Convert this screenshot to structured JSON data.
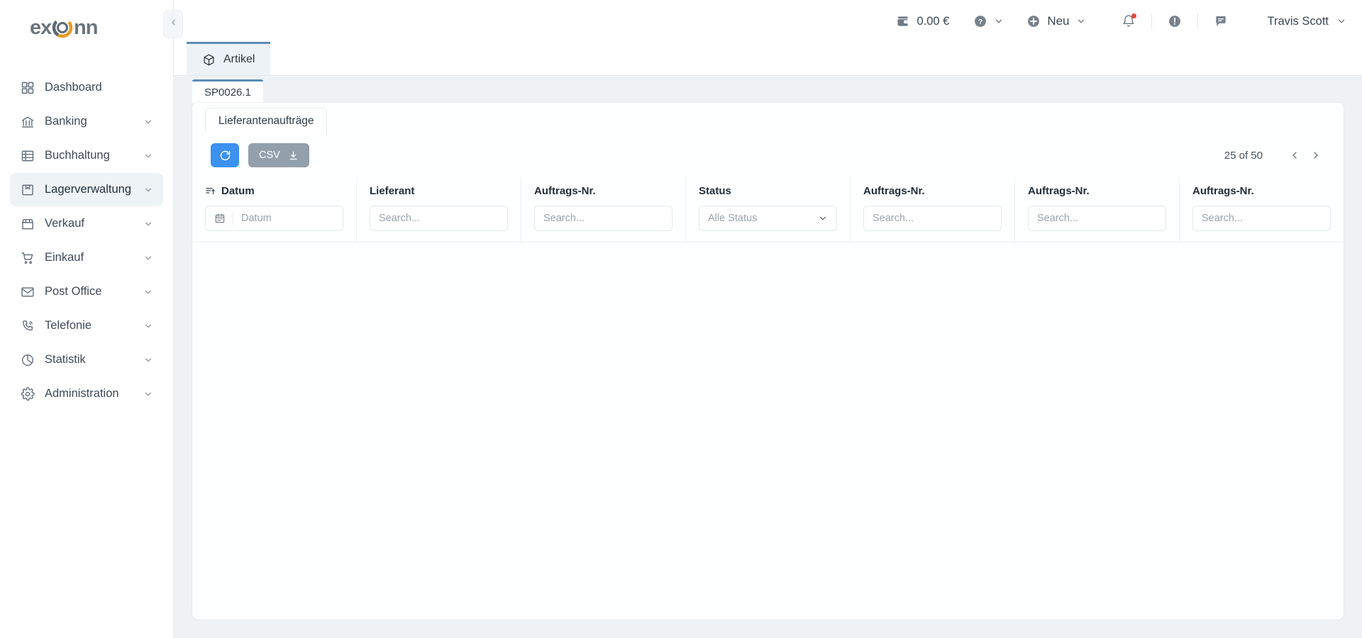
{
  "brand": {
    "name": "exonn",
    "accent": "#e8991f",
    "text_color": "#5e6a73"
  },
  "sidebar": {
    "collapse_icon": "chevron-left-icon",
    "items": [
      {
        "label": "Dashboard",
        "icon": "grid-icon",
        "has_chevron": false,
        "active": false
      },
      {
        "label": "Banking",
        "icon": "bank-icon",
        "has_chevron": true,
        "active": false
      },
      {
        "label": "Buchhaltung",
        "icon": "ledger-icon",
        "has_chevron": true,
        "active": false
      },
      {
        "label": "Lagerverwaltung",
        "icon": "box-archive-icon",
        "has_chevron": true,
        "active": true
      },
      {
        "label": "Verkauf",
        "icon": "store-icon",
        "has_chevron": true,
        "active": false
      },
      {
        "label": "Einkauf",
        "icon": "cart-icon",
        "has_chevron": true,
        "active": false
      },
      {
        "label": "Post Office",
        "icon": "envelope-icon",
        "has_chevron": true,
        "active": false
      },
      {
        "label": "Telefonie",
        "icon": "phone-icon",
        "has_chevron": true,
        "active": false
      },
      {
        "label": "Statistik",
        "icon": "pie-chart-icon",
        "has_chevron": true,
        "active": false
      },
      {
        "label": "Administration",
        "icon": "gear-icon",
        "has_chevron": true,
        "active": false
      }
    ]
  },
  "topbar": {
    "wallet": {
      "icon": "wallet-icon",
      "amount": "0.00 €"
    },
    "help": {
      "icon": "question-circle-icon",
      "chevron": "chevron-down-icon"
    },
    "new": {
      "icon": "plus-circle-icon",
      "label": "Neu",
      "chevron": "chevron-down-icon"
    },
    "notifications": {
      "icon": "bell-icon",
      "has_badge": true,
      "badge_color": "#e8453c"
    },
    "alerts": {
      "icon": "exclamation-circle-icon"
    },
    "messages": {
      "icon": "chat-bubble-icon"
    },
    "user": {
      "name": "Travis Scott",
      "chevron": "chevron-down-icon"
    }
  },
  "tabs": {
    "main": {
      "label": "Artikel",
      "icon": "cube-icon",
      "active": true,
      "accent": "#5b8db8"
    },
    "sub": {
      "label": "SP0026.1",
      "active": true
    },
    "inner": {
      "label": "Lieferantenaufträge",
      "active": true
    }
  },
  "toolbar": {
    "refresh": {
      "icon": "refresh-icon",
      "label": "",
      "color": "#3b92ef"
    },
    "csv": {
      "label": "CSV",
      "icon": "download-icon",
      "color": "#93a0ab"
    },
    "pagination": {
      "count": "25 of 50",
      "prev_icon": "chevron-left-icon",
      "next_icon": "chevron-right-icon"
    }
  },
  "table": {
    "columns": [
      {
        "header": "Datum",
        "sort_icon": "sort-asc-icon",
        "filter_type": "date",
        "placeholder": "Datum",
        "icon": "calendar-icon"
      },
      {
        "header": "Lieferant",
        "filter_type": "search",
        "placeholder": "Search..."
      },
      {
        "header": "Auftrags-Nr.",
        "filter_type": "search",
        "placeholder": "Search..."
      },
      {
        "header": "Status",
        "filter_type": "select",
        "placeholder": "Alle Status",
        "chevron": "chevron-down-icon"
      },
      {
        "header": "Auftrags-Nr.",
        "filter_type": "search",
        "placeholder": "Search..."
      },
      {
        "header": "Auftrags-Nr.",
        "filter_type": "search",
        "placeholder": "Search..."
      },
      {
        "header": "Auftrags-Nr.",
        "filter_type": "search",
        "placeholder": "Search..."
      }
    ],
    "rows": []
  }
}
